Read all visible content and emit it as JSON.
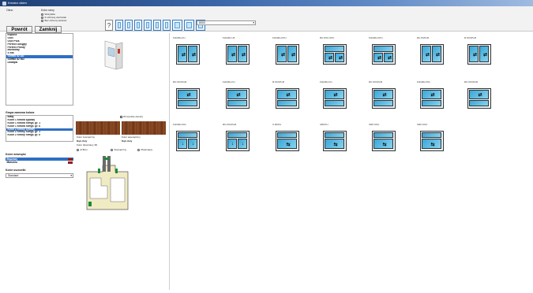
{
  "window": {
    "title": "Kreator okien"
  },
  "toolbar": {
    "system_label": "Okno",
    "color_section_label": "Kolor ramy",
    "radio_options": [
      {
        "label": "Wszystkie",
        "selected": true
      },
      {
        "label": "Z ochroną uszczelek",
        "selected": false
      },
      {
        "label": "Bez ochrony kolorów",
        "selected": false
      }
    ],
    "restore_label": "Powrót",
    "close_label": "Zamknij",
    "help_label": "?",
    "series_value": "8000"
  },
  "profiles": {
    "items": [
      "Expone",
      "OSN",
      "OSN Plus",
      "Perfect Okrągły",
      "Perfect Prosty",
      "Brzozowy",
      "S 9zc",
      "SoftNo 82 AD",
      "SoftNo 82 MD",
      "Dodajiki"
    ],
    "selected_index": 7
  },
  "color_group": {
    "heading": "Grupa zamowa kolora",
    "items": [
      "Biały",
      "Kolor 1 strona typowy",
      "Kolor 1 strona nietyp. gr. 1",
      "Kolor 1 strona nietyp. gr. II",
      "Kolor 2 strony typowy",
      "Kolor 2 strony nietyp. gr. 1",
      "Kolor 2 strony nietyp. gr. II"
    ],
    "selected_index": 4
  },
  "inner_color": {
    "heading": "Kolor wewnątrz",
    "items": [
      {
        "label": "Brązowy",
        "selected": true,
        "color": "#9a1b1b"
      },
      {
        "label": "Mahoniu",
        "selected": false,
        "color": "#8e1f1f"
      }
    ]
  },
  "seal_color": {
    "heading": "Kolor uszczelki",
    "value": "Standard"
  },
  "middle": {
    "checkbox_label": "Wi wyrobie okostry",
    "outer_label": "Kolor zewnętrzny",
    "outer_value": "Dąb złoty",
    "inner_label": "Kolor wewnętrzny",
    "inner_value": "Dąb złoty",
    "wood_label": "Kolor drewniany 3D",
    "radio_options": [
      "di Bom",
      "Zewnętrzny",
      "Plastmajny"
    ]
  },
  "grid": {
    "tiles": [
      {
        "label": "FsKdDs.KU",
        "type": "v2",
        "row": 0,
        "col": 0
      },
      {
        "label": "FsKdDs.UK",
        "type": "v2",
        "row": 0,
        "col": 1
      },
      {
        "label": "FsKdDs.KKU",
        "type": "v2t",
        "row": 0,
        "col": 2
      },
      {
        "label": "RU.KKU.KKU",
        "type": "s2",
        "row": 0,
        "col": 3
      },
      {
        "label": "FsKdDs.KKU",
        "type": "s2",
        "row": 0,
        "col": 4
      },
      {
        "label": "RU.KKPoR",
        "type": "v2t",
        "row": 0,
        "col": 5
      },
      {
        "label": "R.KKUPoR",
        "type": "v2t",
        "row": 0,
        "col": 6
      },
      {
        "label": "RU.KKUPoR",
        "type": "v2b",
        "row": 1,
        "col": 0
      },
      {
        "label": "FsKdDs.KU",
        "type": "v2b",
        "row": 1,
        "col": 1
      },
      {
        "label": "R.KKUPoR",
        "type": "v2b",
        "row": 1,
        "col": 2
      },
      {
        "label": "FsKdDs.KU",
        "type": "v2b",
        "row": 1,
        "col": 3
      },
      {
        "label": "RU.KKUPoR",
        "type": "v2b",
        "row": 1,
        "col": 4
      },
      {
        "label": "FsKdDs.KKL",
        "type": "v2b",
        "row": 1,
        "col": 5
      },
      {
        "label": "RU.KKUPoR",
        "type": "v2b",
        "row": 1,
        "col": 6
      },
      {
        "label": "FsKdDs.KKL",
        "type": "t2",
        "row": 2,
        "col": 0
      },
      {
        "label": "RU.KKUPoR",
        "type": "t2",
        "row": 2,
        "col": 1
      },
      {
        "label": "U.RKKU",
        "type": "t1",
        "row": 2,
        "col": 2
      },
      {
        "label": "URKKU",
        "type": "t1",
        "row": 2,
        "col": 3
      },
      {
        "label": "URK.KKU",
        "type": "t1",
        "row": 2,
        "col": 4
      },
      {
        "label": "URK.KKU",
        "type": "t1",
        "row": 2,
        "col": 5
      }
    ]
  }
}
